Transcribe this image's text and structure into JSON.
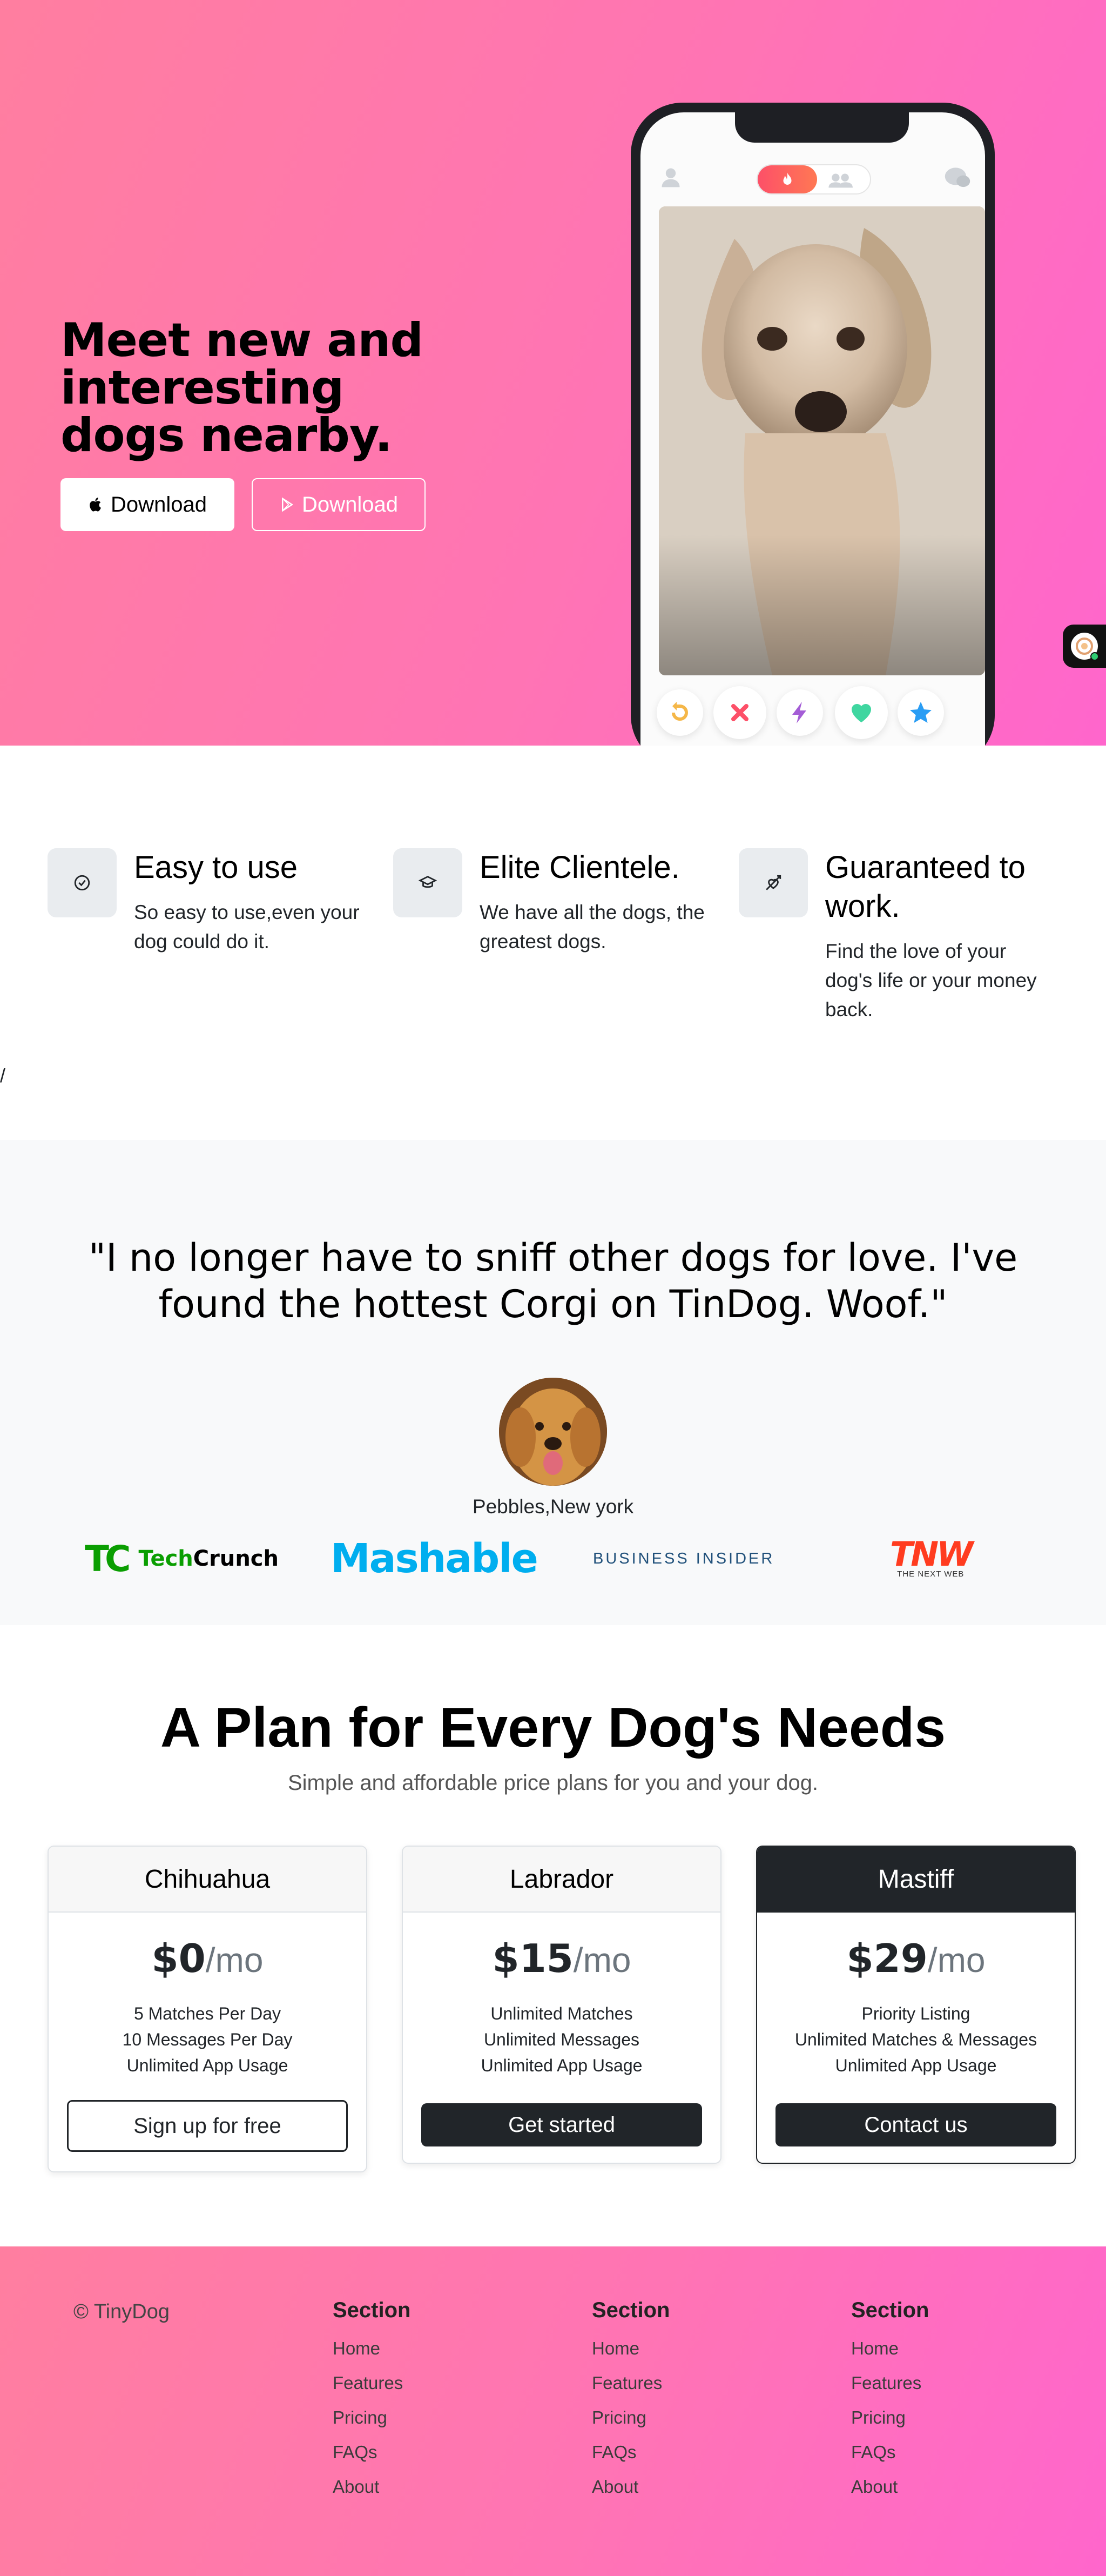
{
  "hero": {
    "headline": "Meet new and interesting dogs nearby.",
    "apple_button": "Download",
    "play_button": "Download",
    "gradient_colors": [
      "#ff7ea0",
      "#ff66cc"
    ]
  },
  "features": [
    {
      "title": "Easy to use",
      "text": "So easy to use,even your dog could do it.",
      "icon": "check-circle-icon"
    },
    {
      "title": "Elite Clientele.",
      "text": "We have all the dogs, the greatest dogs.",
      "icon": "graduation-cap-icon"
    },
    {
      "title": "Guaranteed to work.",
      "text": "Find the love of your dog's life or your money back.",
      "icon": "heart-arrow-icon"
    }
  ],
  "stray_text": "/",
  "testimonial": {
    "quote": "\"I no longer have to sniff other dogs for love. I've found the hottest Corgi on TinDog. Woof.\"",
    "author": "Pebbles,New york"
  },
  "press": {
    "techcrunch_mark": "TC",
    "techcrunch_word_a": "Tech",
    "techcrunch_word_b": "Crunch",
    "mashable": "Mashable",
    "business_insider": "BUSINESS INSIDER",
    "tnw_big": "TNW",
    "tnw_small": "THE NEXT WEB"
  },
  "pricing": {
    "title": "A Plan for Every Dog's Needs",
    "subtitle": "Simple and affordable price plans for you and your dog.",
    "plans": [
      {
        "name": "Chihuahua",
        "price": "$0",
        "period": "/mo",
        "features": [
          "5 Matches Per Day",
          "10 Messages Per Day",
          "Unlimited App Usage"
        ],
        "cta": "Sign up for free"
      },
      {
        "name": "Labrador",
        "price": "$15",
        "period": "/mo",
        "features": [
          "Unlimited Matches",
          "Unlimited Messages",
          "Unlimited App Usage"
        ],
        "cta": "Get started"
      },
      {
        "name": "Mastiff",
        "price": "$29",
        "period": "/mo",
        "features": [
          "Priority Listing",
          "Unlimited Matches & Messages",
          "Unlimited App Usage"
        ],
        "cta": "Contact us"
      }
    ]
  },
  "footer": {
    "copyright": "© TinyDog",
    "columns": [
      {
        "heading": "Section",
        "links": [
          "Home",
          "Features",
          "Pricing",
          "FAQs",
          "About"
        ]
      },
      {
        "heading": "Section",
        "links": [
          "Home",
          "Features",
          "Pricing",
          "FAQs",
          "About"
        ]
      },
      {
        "heading": "Section",
        "links": [
          "Home",
          "Features",
          "Pricing",
          "FAQs",
          "About"
        ]
      }
    ]
  }
}
